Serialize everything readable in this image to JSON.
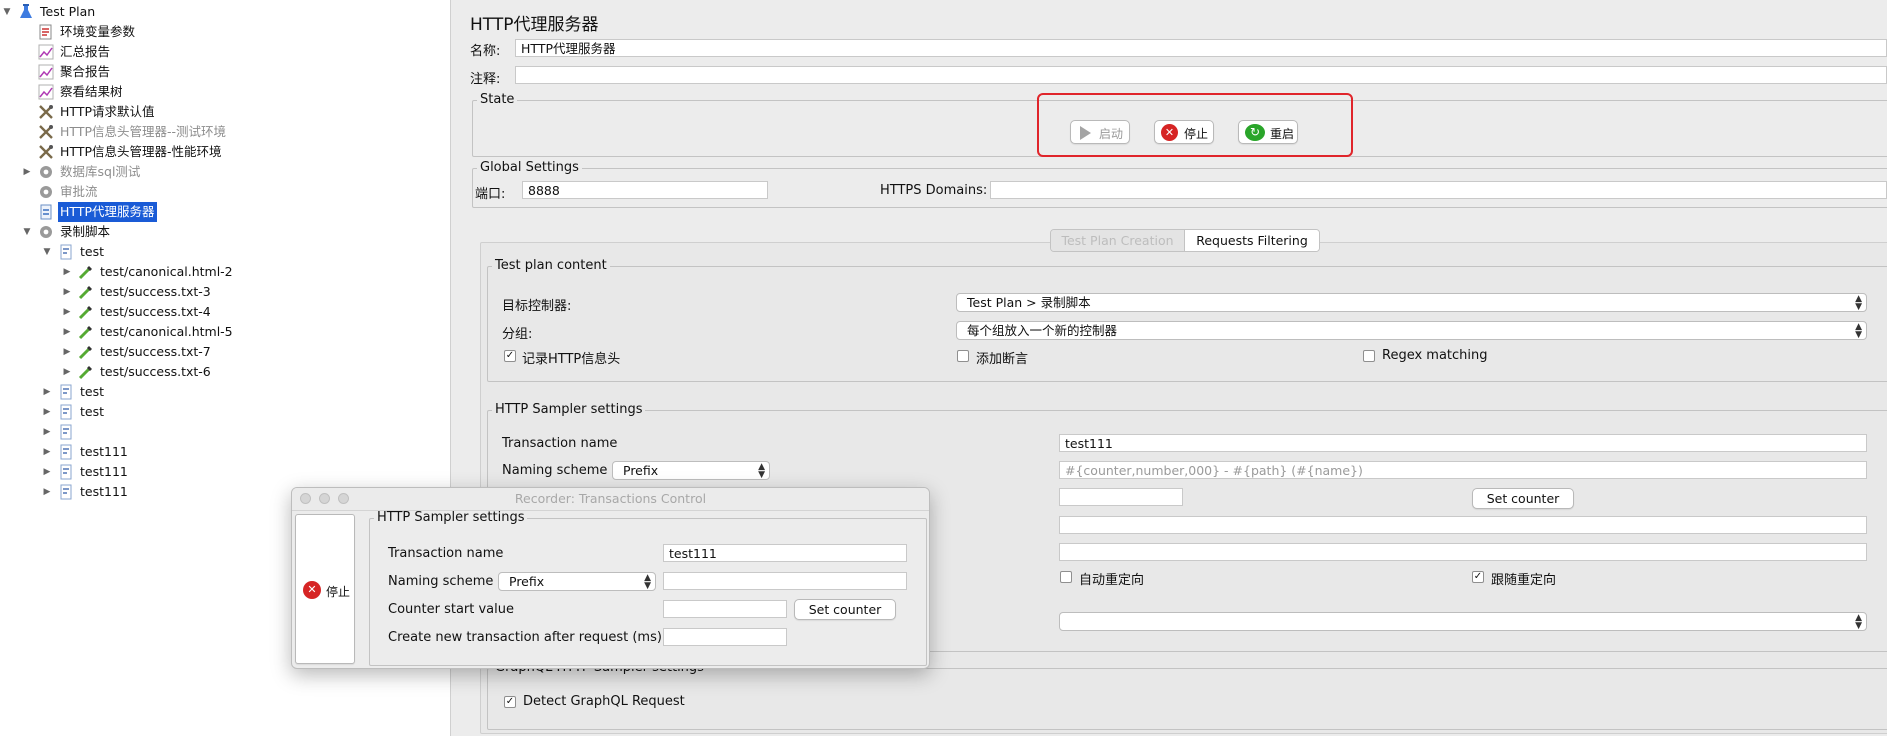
{
  "tree": {
    "items": [
      {
        "label": "Test Plan",
        "icon": "flask-icon",
        "arrow": "▼",
        "state": "normal"
      },
      {
        "label": "环境变量参数",
        "icon": "config-icon",
        "arrow": "",
        "state": "normal"
      },
      {
        "label": "汇总报告",
        "icon": "graph-icon",
        "arrow": "",
        "state": "normal"
      },
      {
        "label": "聚合报告",
        "icon": "graph-icon",
        "arrow": "",
        "state": "normal"
      },
      {
        "label": "察看结果树",
        "icon": "graph-icon",
        "arrow": "",
        "state": "normal"
      },
      {
        "label": "HTTP请求默认值",
        "icon": "wrench-icon",
        "arrow": "",
        "state": "normal"
      },
      {
        "label": "HTTP信息头管理器--测试环境",
        "icon": "wrench-icon",
        "arrow": "",
        "state": "disabled"
      },
      {
        "label": "HTTP信息头管理器-性能环境",
        "icon": "wrench-icon",
        "arrow": "",
        "state": "normal"
      },
      {
        "label": "数据库sql测试",
        "icon": "gear-icon",
        "arrow": "▶",
        "state": "disabled"
      },
      {
        "label": "审批流",
        "icon": "gear-icon",
        "arrow": "",
        "state": "disabled"
      },
      {
        "label": "HTTP代理服务器",
        "icon": "proxy-icon",
        "arrow": "",
        "state": "selected"
      },
      {
        "label": "录制脚本",
        "icon": "gear-icon",
        "arrow": "▼",
        "state": "normal"
      },
      {
        "label": "test",
        "icon": "controller-icon",
        "arrow": "▼",
        "state": "normal"
      },
      {
        "label": "test/canonical.html-2",
        "icon": "sampler-icon",
        "arrow": "▶",
        "state": "normal"
      },
      {
        "label": "test/success.txt-3",
        "icon": "sampler-icon",
        "arrow": "▶",
        "state": "normal"
      },
      {
        "label": "test/success.txt-4",
        "icon": "sampler-icon",
        "arrow": "▶",
        "state": "normal"
      },
      {
        "label": "test/canonical.html-5",
        "icon": "sampler-icon",
        "arrow": "▶",
        "state": "normal"
      },
      {
        "label": "test/success.txt-7",
        "icon": "sampler-icon",
        "arrow": "▶",
        "state": "normal"
      },
      {
        "label": "test/success.txt-6",
        "icon": "sampler-icon",
        "arrow": "▶",
        "state": "normal"
      },
      {
        "label": "test",
        "icon": "controller-icon",
        "arrow": "▶",
        "state": "normal"
      },
      {
        "label": "test",
        "icon": "controller-icon",
        "arrow": "▶",
        "state": "normal"
      },
      {
        "label": "",
        "icon": "controller-icon",
        "arrow": "▶",
        "state": "normal"
      },
      {
        "label": "test111",
        "icon": "controller-icon",
        "arrow": "▶",
        "state": "normal"
      },
      {
        "label": "test111",
        "icon": "controller-icon",
        "arrow": "▶",
        "state": "normal"
      },
      {
        "label": "test111",
        "icon": "controller-icon",
        "arrow": "▶",
        "state": "normal"
      }
    ]
  },
  "header": {
    "title": "HTTP代理服务器",
    "name_label": "名称:",
    "name_value": "HTTP代理服务器",
    "comment_label": "注释:",
    "comment_value": ""
  },
  "state": {
    "legend": "State",
    "start_label": "启动",
    "stop_label": "停止",
    "restart_label": "重启",
    "highlight_color": "#e0252b"
  },
  "global": {
    "legend": "Global Settings",
    "port_label": "端口:",
    "port_value": "8888",
    "https_label": "HTTPS Domains:",
    "https_value": ""
  },
  "tabs": [
    {
      "label": "Test Plan Creation",
      "active": false
    },
    {
      "label": "Requests Filtering",
      "active": true
    }
  ],
  "plan": {
    "legend": "Test plan content",
    "target_label": "目标控制器:",
    "target_value": "Test Plan > 录制脚本",
    "group_label": "分组:",
    "group_value": "每个组放入一个新的控制器",
    "record_headers_label": "记录HTTP信息头",
    "record_headers_checked": true,
    "add_assertion_label": "添加断言",
    "add_assertion_checked": false,
    "regex_label": "Regex matching",
    "regex_checked": false
  },
  "sampler": {
    "legend": "HTTP Sampler settings",
    "transaction_label": "Transaction name",
    "transaction_value": "test111",
    "naming_label": "Naming scheme",
    "naming_value": "Prefix",
    "naming_placeholder": "#{counter,number,000} - #{path} (#{name})",
    "set_counter_label": "Set counter",
    "auto_redirect_label": "自动重定向",
    "auto_redirect_checked": false,
    "follow_redirect_label": "跟随重定向",
    "follow_redirect_checked": true
  },
  "graphql": {
    "legend": "GraphQL HTTP Sampler settings",
    "detect_label": "Detect GraphQL Request",
    "detect_checked": true
  },
  "dialog": {
    "title": "Recorder: Transactions Control",
    "stop_label": "停止",
    "legend": "HTTP Sampler settings",
    "transaction_label": "Transaction name",
    "transaction_value": "test111",
    "naming_label": "Naming scheme",
    "naming_value": "Prefix",
    "counter_label": "Counter start value",
    "counter_value": "",
    "set_counter_label": "Set counter",
    "new_tx_label": "Create new transaction after request (ms):",
    "new_tx_value": ""
  }
}
